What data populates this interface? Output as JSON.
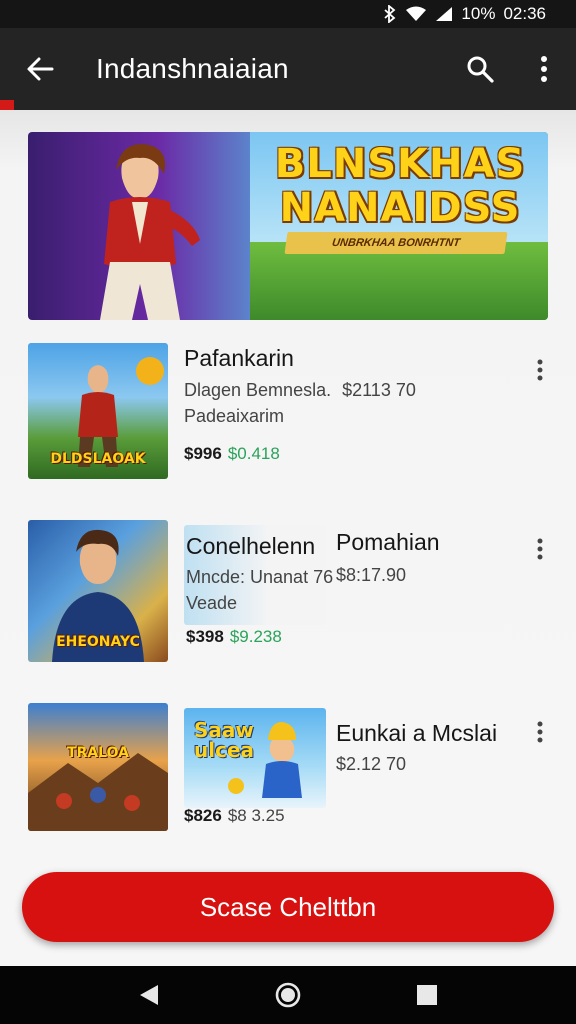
{
  "status_bar": {
    "battery": "10%",
    "time": "02:36",
    "icons": [
      "bluetooth-icon",
      "wifi-icon",
      "signal-icon"
    ]
  },
  "app_bar": {
    "title": "Indanshnaiaian",
    "back_icon": "arrow-back-icon",
    "search_icon": "search-icon",
    "more_icon": "more-vert-icon"
  },
  "banner": {
    "title_line1": "BLNSKHAS",
    "title_line2": "NANAIDSS",
    "subtitle": "UNBRKHAA BONRHTNT"
  },
  "items": [
    {
      "title": "Pafankarin",
      "subtitle_line1": "Dlagen Bemnesla.",
      "subtitle_price": "$2113 70",
      "subtitle_line2": "Padeaixarim",
      "price": "$996",
      "price_alt": "$0.418",
      "thumb_label": "DLDSLAOAK"
    },
    {
      "title": "Conelhelenn",
      "title_right": "Pomahian",
      "subtitle_line1": "Mncde: Unanat 76",
      "subtitle_price": "$8:17.90",
      "subtitle_line2": "Veade",
      "price": "$398",
      "price_alt": "$9.238",
      "thumb_label": "EHEONAYC"
    },
    {
      "title": "Eunkai a Mcslai",
      "subtitle_price": "$2.12 70",
      "price": "$826",
      "price_alt": "$8 3.25",
      "thumb_label": "TRALOA",
      "thumb2_label": "Saaw ulcea"
    }
  ],
  "cta": {
    "label": "Scase Chelttbn"
  },
  "colors": {
    "accent": "#d7110f",
    "app_bar": "#242424",
    "price_green": "#2ba35a"
  }
}
